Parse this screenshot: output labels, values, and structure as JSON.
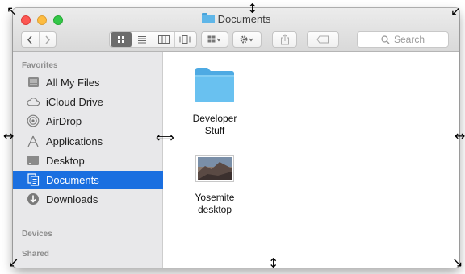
{
  "window": {
    "title": "Documents",
    "title_icon": "folder-icon"
  },
  "toolbar": {
    "back_icon": "chevron-left-icon",
    "forward_icon": "chevron-right-icon",
    "view_modes": [
      "icon-view",
      "list-view",
      "column-view",
      "cover-flow-view"
    ],
    "active_view": "icon-view",
    "arrange_icon": "arrange-grid-icon",
    "action_icon": "gear-icon",
    "share_icon": "share-icon",
    "tag_icon": "tag-icon",
    "search_placeholder": "Search"
  },
  "sidebar": {
    "sections": {
      "favorites": "Favorites",
      "devices": "Devices",
      "shared": "Shared"
    },
    "items": [
      {
        "label": "All My Files",
        "icon": "all-files-icon",
        "selected": false
      },
      {
        "label": "iCloud Drive",
        "icon": "cloud-icon",
        "selected": false
      },
      {
        "label": "AirDrop",
        "icon": "airdrop-icon",
        "selected": false
      },
      {
        "label": "Applications",
        "icon": "applications-icon",
        "selected": false
      },
      {
        "label": "Desktop",
        "icon": "desktop-icon",
        "selected": false
      },
      {
        "label": "Documents",
        "icon": "documents-icon",
        "selected": true
      },
      {
        "label": "Downloads",
        "icon": "downloads-icon",
        "selected": false
      }
    ]
  },
  "content": {
    "files": [
      {
        "line1": "Developer",
        "line2": "Stuff",
        "kind": "folder"
      },
      {
        "line1": "Yosemite",
        "line2": "desktop",
        "kind": "image"
      }
    ]
  },
  "colors": {
    "accent": "#1a6fe0",
    "folder": "#5fb6e8",
    "close": "#fc5753",
    "minimize": "#fdbc40",
    "maximize": "#33c748"
  }
}
